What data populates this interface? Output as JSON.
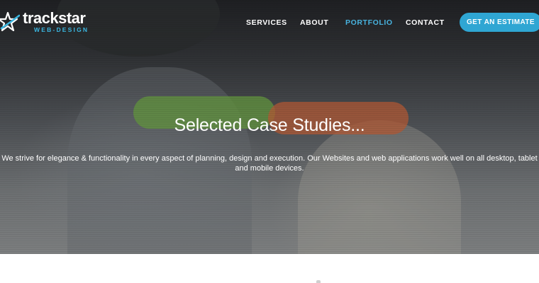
{
  "brand": {
    "name": "trackstar",
    "tagline": "WEB-DESIGN",
    "accent_color": "#2fa6d3",
    "star_icon": "star-swoosh-icon"
  },
  "nav": {
    "items": [
      {
        "label": "SERVICES",
        "active": false
      },
      {
        "label": "ABOUT",
        "active": false
      },
      {
        "label": "PORTFOLIO",
        "active": true
      },
      {
        "label": "CONTACT",
        "active": false
      }
    ],
    "cta_label": "GET AN ESTIMATE"
  },
  "hero": {
    "title": "Selected Case Studies...",
    "description_line1": "We strive for elegance & functionality in every aspect of planning, design and execution. Our Websites and web applications work well on all desktop, tablet",
    "description_line2": "and mobile devices."
  }
}
